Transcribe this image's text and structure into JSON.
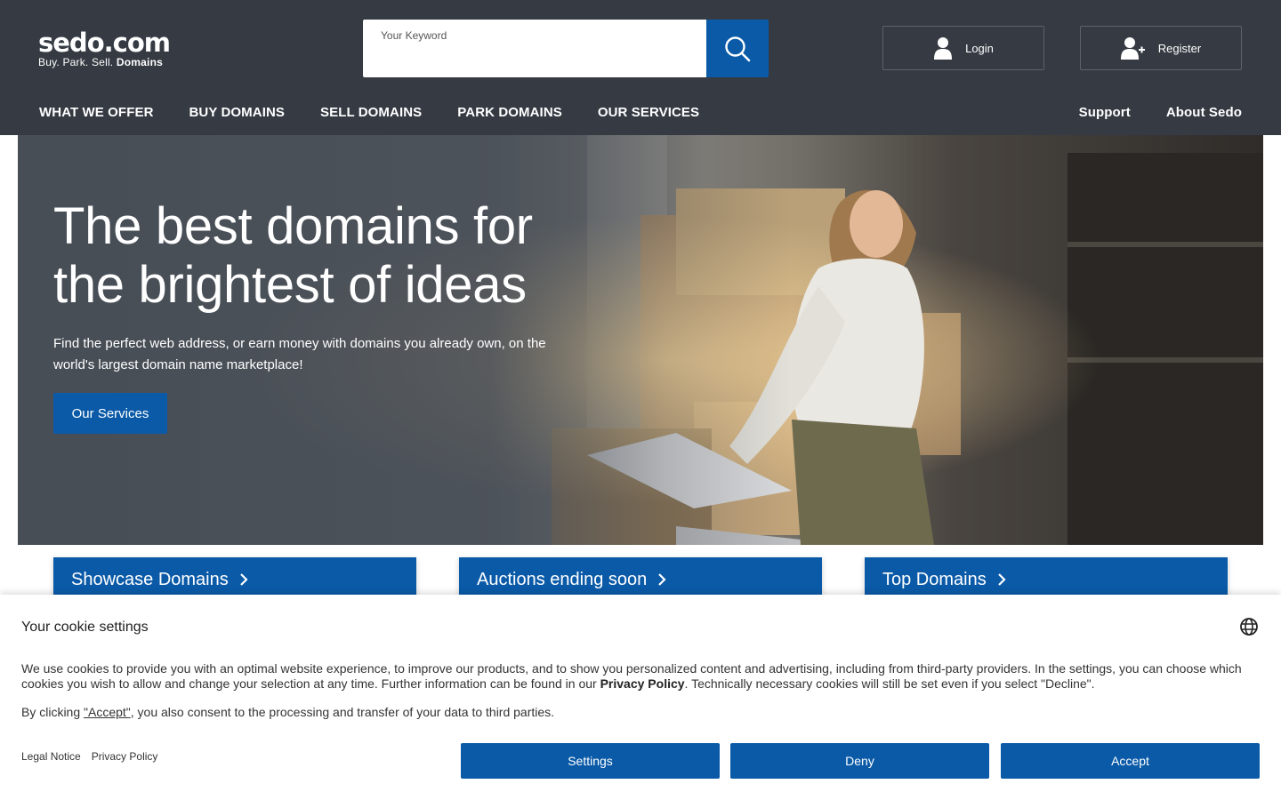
{
  "header": {
    "logo_main": "sedo.com",
    "logo_tagline": "Buy.  Park.  Sell.",
    "logo_tagline_bold": "Domains",
    "search_label": "Your Keyword",
    "search_placeholder": "",
    "login_label": "Login",
    "register_label": "Register",
    "nav": [
      "WHAT WE OFFER",
      "BUY DOMAINS",
      "SELL DOMAINS",
      "PARK DOMAINS",
      "OUR SERVICES"
    ],
    "nav_right": [
      "Support",
      "About Sedo"
    ]
  },
  "hero": {
    "title": "The best domains for the brightest of ideas",
    "text": "Find the perfect web address, or earn money with domains you already own, on the world's largest domain name marketplace!",
    "cta": "Our Services"
  },
  "cards": [
    "Showcase Domains",
    "Auctions ending soon",
    "Top Domains"
  ],
  "cookie": {
    "title": "Your cookie settings",
    "text_before": "We use cookies to provide you with an optimal website experience, to improve our products, and to show you personalized content and advertising, including from third-party providers. In the settings, you can choose which cookies you wish to allow and change your selection at any time. Further information can be found in our ",
    "text_link": "Privacy Policy",
    "text_after": ". Technically necessary cookies will still be set even if you select \"Decline\".",
    "consent_before": "By clicking ",
    "consent_link": "\"Accept\"",
    "consent_after": ", you also consent to the processing and transfer of your data to third parties.",
    "links": [
      "Legal Notice",
      "Privacy Policy"
    ],
    "buttons": {
      "settings": "Settings",
      "deny": "Deny",
      "accept": "Accept"
    }
  },
  "colors": {
    "header_bg": "#353a43",
    "brand_blue": "#0a5aa8"
  }
}
